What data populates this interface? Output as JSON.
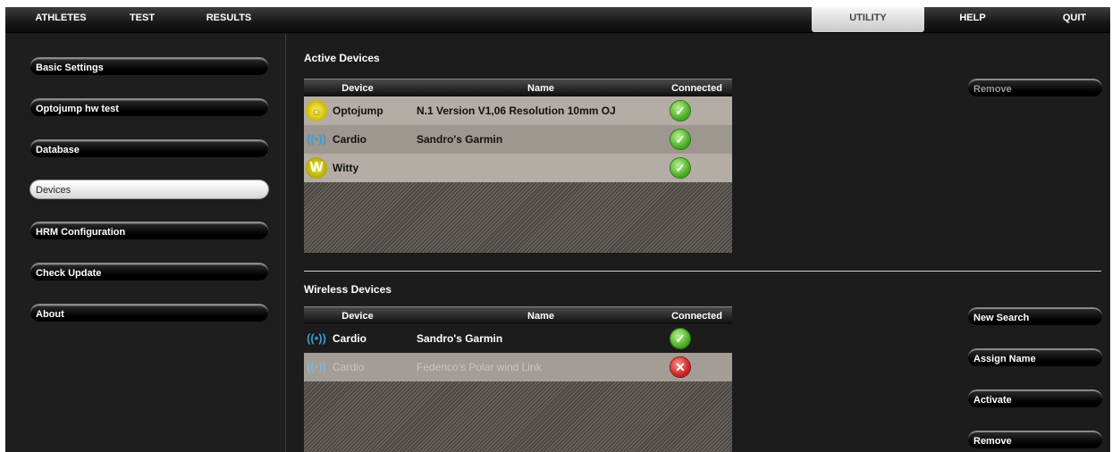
{
  "menu": {
    "left_tabs": [
      "ATHLETES",
      "TEST",
      "RESULTS"
    ],
    "utility": "UTILITY",
    "help": "HELP",
    "quit": "QUIT"
  },
  "sidebar": {
    "items": [
      {
        "label": "Basic Settings"
      },
      {
        "label": "Optojump hw test"
      },
      {
        "label": "Database"
      },
      {
        "label": "Devices"
      },
      {
        "label": "HRM Configuration"
      },
      {
        "label": "Check Update"
      },
      {
        "label": "About"
      }
    ],
    "selected": "Devices"
  },
  "active_devices": {
    "title": "Active Devices",
    "columns": [
      "Device",
      "Name",
      "Connected"
    ],
    "rows": [
      {
        "device": "Optojump",
        "name": "N.1 Version V1,06 Resolution 10mm OJ",
        "connected": true,
        "icon": "optojump-icon"
      },
      {
        "device": "Cardio",
        "name": "Sandro's Garmin",
        "connected": true,
        "icon": "wireless-icon"
      },
      {
        "device": "Witty",
        "name": "",
        "connected": true,
        "icon": "witty-icon"
      }
    ],
    "remove_button": "Remove"
  },
  "wireless_devices": {
    "title": "Wireless Devices",
    "columns": [
      "Device",
      "Name",
      "Connected"
    ],
    "rows": [
      {
        "device": "Cardio",
        "name": "Sandro's Garmin",
        "connected": true,
        "icon": "wireless-icon"
      },
      {
        "device": "Cardio",
        "name": "Federico's Polar wind Link",
        "connected": false,
        "icon": "wireless-icon"
      }
    ],
    "buttons": {
      "new_search": "New Search",
      "assign_name": "Assign Name",
      "activate": "Activate",
      "remove": "Remove"
    }
  },
  "colors": {
    "selected_row": "#b4ada5",
    "ok_green": "#3fa51c",
    "error_red": "#c81818",
    "wireless_blue": "#3a9ad9",
    "witty_yellow": "#e0d400"
  }
}
